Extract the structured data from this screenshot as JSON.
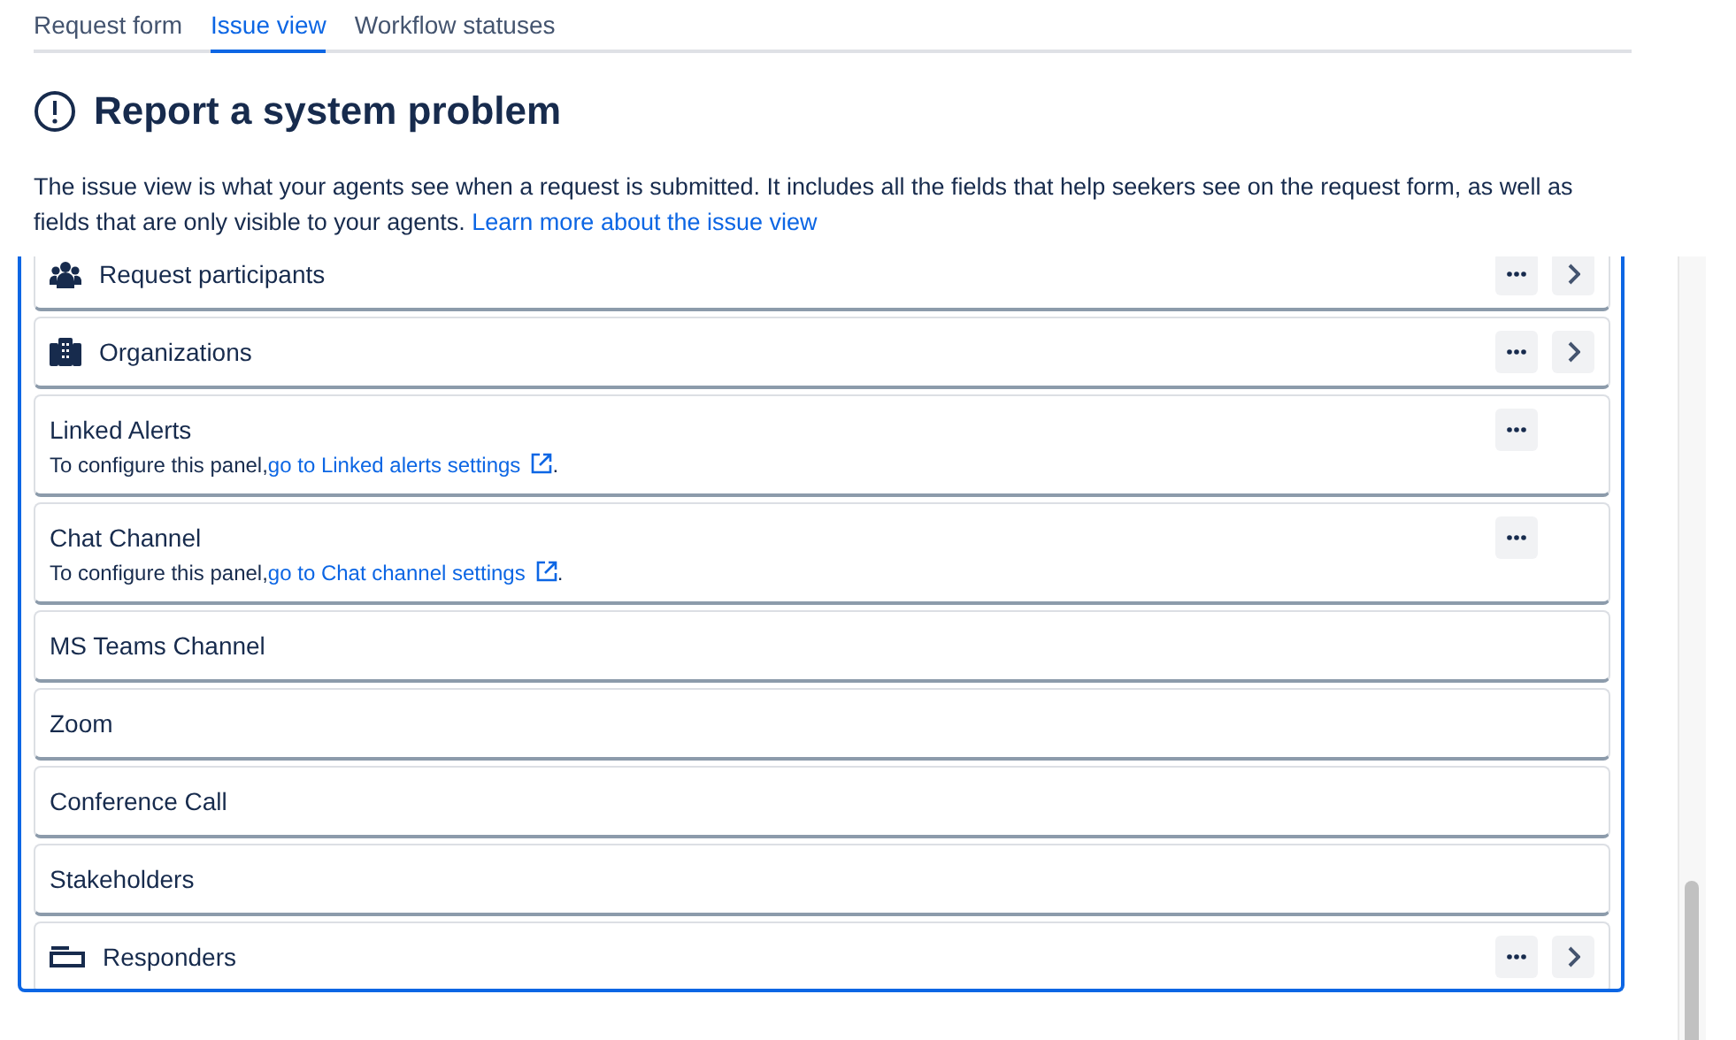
{
  "tabs": [
    {
      "label": "Request form",
      "selected": false
    },
    {
      "label": "Issue view",
      "selected": true
    },
    {
      "label": "Workflow statuses",
      "selected": false
    }
  ],
  "heading": {
    "title": "Report a system problem"
  },
  "description": {
    "text": "The issue view is what your agents see when a request is submitted. It includes all the fields that help seekers see on the request form, as well as fields that are only visible to your agents.",
    "link": "Learn more about the issue view"
  },
  "fields": [
    {
      "label": "Request participants",
      "kind": "people",
      "more": true,
      "chevron": true
    },
    {
      "label": "Organizations",
      "kind": "building",
      "more": true,
      "chevron": true
    },
    {
      "label": "Linked Alerts",
      "more": true,
      "chevron": false,
      "note": "To configure this panel,",
      "link": "go to Linked alerts settings",
      "after": "."
    },
    {
      "label": "Chat Channel",
      "more": true,
      "chevron": false,
      "note": "To configure this panel,",
      "link": "go to Chat channel settings",
      "after": "."
    },
    {
      "label": "MS Teams Channel",
      "more": false,
      "chevron": false
    },
    {
      "label": "Zoom",
      "more": false,
      "chevron": false
    },
    {
      "label": "Conference Call",
      "more": false,
      "chevron": false
    },
    {
      "label": "Stakeholders",
      "more": false,
      "chevron": false
    },
    {
      "label": "Responders",
      "kind": "card",
      "more": true,
      "chevron": true
    }
  ]
}
